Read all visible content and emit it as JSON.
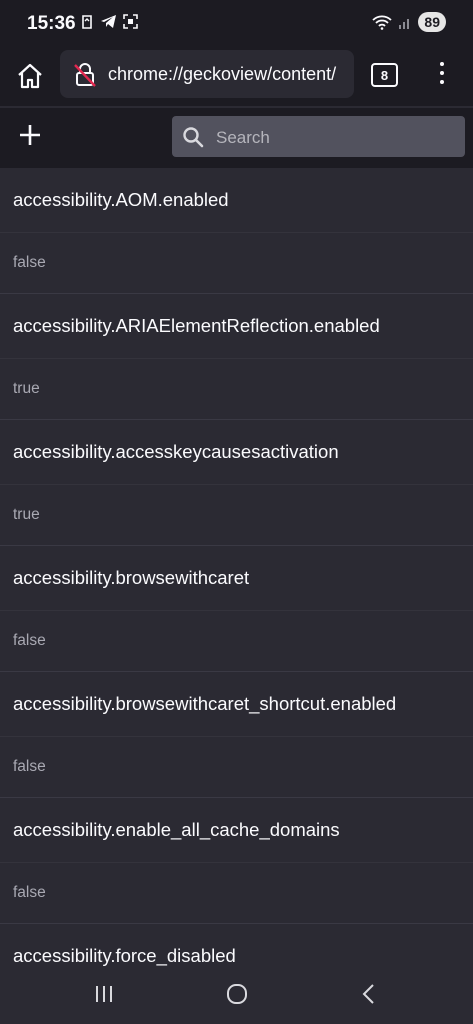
{
  "status_bar": {
    "time": "15:36",
    "battery": "89"
  },
  "toolbar": {
    "url": "chrome://geckoview/content/",
    "tab_count": "8"
  },
  "search": {
    "placeholder": "Search"
  },
  "prefs": [
    {
      "name": "accessibility.AOM.enabled",
      "value": "false"
    },
    {
      "name": "accessibility.ARIAElementReflection.enabled",
      "value": "true"
    },
    {
      "name": "accessibility.accesskeycausesactivation",
      "value": "true"
    },
    {
      "name": "accessibility.browsewithcaret",
      "value": "false"
    },
    {
      "name": "accessibility.browsewithcaret_shortcut.enabled",
      "value": "false"
    },
    {
      "name": "accessibility.enable_all_cache_domains",
      "value": "false"
    },
    {
      "name": "accessibility.force_disabled",
      "value": ""
    }
  ]
}
